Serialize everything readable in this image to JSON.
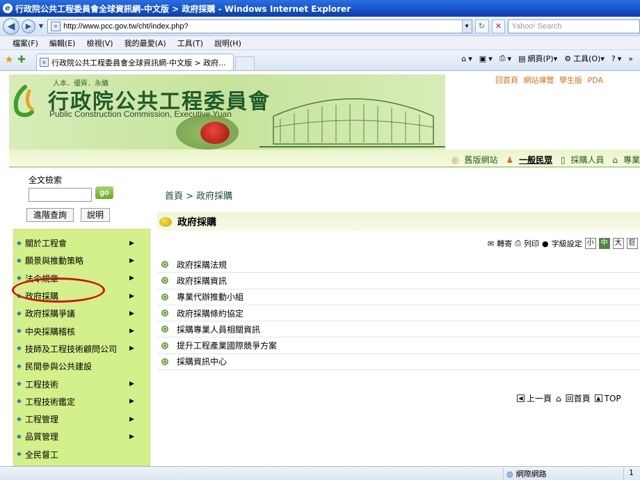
{
  "window": {
    "title": "行政院公共工程委員會全球資訊網-中文版 > 政府採購 - Windows Internet Explorer"
  },
  "browser": {
    "url": "http://www.pcc.gov.tw/cht/index.php?",
    "search_placeholder": "Yahoo! Search",
    "menu": [
      "檔案(F)",
      "編輯(E)",
      "檢視(V)",
      "我的最愛(A)",
      "工具(T)",
      "說明(H)"
    ],
    "tab_title": "行政院公共工程委員會全球資訊網-中文版 > 政府...",
    "tools": {
      "page": "網頁(P)",
      "tools": "工具(O)"
    },
    "status": {
      "zone": "網際網路",
      "zoom": "1"
    }
  },
  "site": {
    "tagline": "人本．優質．永續",
    "name_cn": "行政院公共工程委員會",
    "name_en": "Public Construction Commission,  Executive Yuan",
    "top_links": [
      "回首頁",
      "網站導覽",
      "學生版",
      "PDA"
    ],
    "audience": {
      "old_site": "舊版網站",
      "public": "一般民眾",
      "procurement": "採購人員",
      "pro": "專業技"
    },
    "search_label": "全文檢索",
    "go_label": "go",
    "advanced_label": "進階查詢",
    "help_label": "說明"
  },
  "sidebar": {
    "items": [
      "關於工程會",
      "願景與推動策略",
      "法令規章",
      "政府採購",
      "政府採購爭議",
      "中央採購稽核",
      "技師及工程技術顧問公司",
      "民間參與公共建設",
      "工程技術",
      "工程技術鑑定",
      "工程管理",
      "品質管理",
      "全民督工"
    ]
  },
  "main": {
    "breadcrumb": "首頁 > 政府採購",
    "section_title": "政府採購",
    "tools": {
      "forward": "轉寄",
      "print": "列印",
      "font_size": "字級設定",
      "small": "小",
      "medium": "中",
      "large": "大",
      "huge": "巨"
    },
    "links": [
      "政府採購法規",
      "政府採購資訊",
      "專業代辦推動小組",
      "政府採購條約協定",
      "採購專業人員相關資訊",
      "提升工程產業國際競爭方案",
      "採購資訊中心"
    ],
    "footer": {
      "prev": "上一頁",
      "home": "回首頁",
      "top": "TOP"
    }
  },
  "colors": {
    "title_bar": "#1350c8",
    "sidebar_bg": "#d3f08a",
    "highlight": "#d41010",
    "banner": "#c6e39b"
  }
}
